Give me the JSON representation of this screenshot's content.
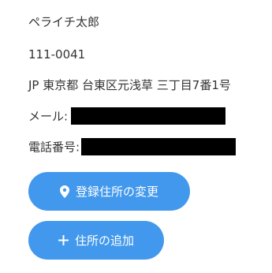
{
  "address_card": {
    "name": "ペライチ太郎",
    "postal_code": "111-0041",
    "address": "JP 東京都 台東区元浅草 三丁目7番1号",
    "email_label": "メール:",
    "phone_label": "電話番号:"
  },
  "buttons": {
    "change_label": "登録住所の変更",
    "change_icon": "location-pin-icon",
    "add_label": "住所の追加",
    "add_icon": "plus-icon"
  },
  "colors": {
    "button_bg": "#4298ec",
    "button_text": "#ffffff",
    "text": "#333333",
    "redaction": "#000000"
  }
}
